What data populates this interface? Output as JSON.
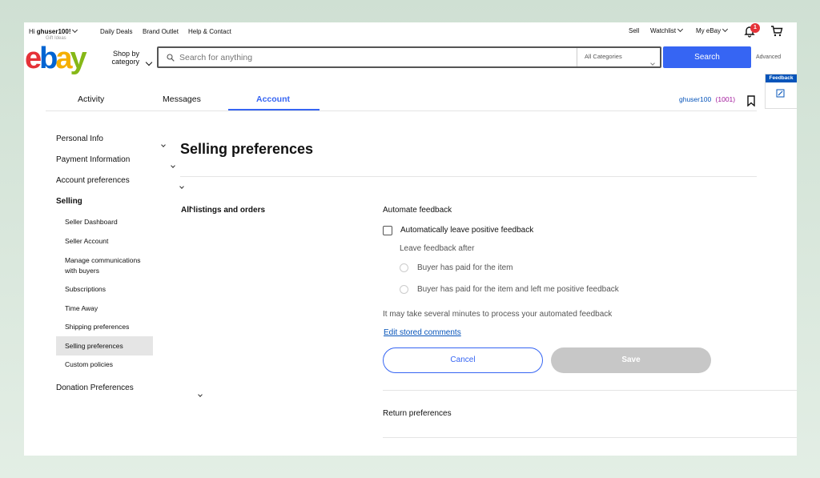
{
  "header": {
    "greeting_prefix": "Hi",
    "username": "ghuser100!",
    "greeting_sub": "Gift Ideas",
    "daily_deals": "Daily Deals",
    "brand_outlet": "Brand Outlet",
    "help_contact": "Help & Contact",
    "sell": "Sell",
    "watchlist": "Watchlist",
    "my_ebay": "My eBay",
    "notification_count": "1"
  },
  "logo": {
    "e": "e",
    "b": "b",
    "a": "a",
    "y": "y"
  },
  "search": {
    "shop_by_category": "Shop by category",
    "shop_line1": "Shop by",
    "shop_line2": "category",
    "placeholder": "Search for anything",
    "category": "All Categories",
    "button": "Search",
    "advanced": "Advanced"
  },
  "feedback_tab": {
    "label": "Feedback"
  },
  "tabs": [
    {
      "label": "Activity"
    },
    {
      "label": "Messages"
    },
    {
      "label": "Account"
    }
  ],
  "user": {
    "name": "ghuser100",
    "score": "(1001)"
  },
  "sidebar": {
    "personal_info": "Personal Info",
    "payment_information": "Payment Information",
    "account_preferences": "Account preferences",
    "selling": "Selling",
    "selling_items": [
      "Seller Dashboard",
      "Seller Account",
      "Manage communications with buyers",
      "Subscriptions",
      "Time Away",
      "Shipping preferences",
      "Selling preferences",
      "Custom policies"
    ],
    "manage_line1": "Manage communications",
    "manage_line2": "with buyers",
    "donation_preferences": "Donation Preferences"
  },
  "main": {
    "title": "Selling preferences",
    "section_label": "All listings and orders",
    "automate_feedback": "Automate feedback",
    "auto_leave_label": "Automatically leave positive feedback",
    "auto_leave_checked": false,
    "leave_after": "Leave feedback after",
    "option1": "Buyer has paid for the item",
    "option2": "Buyer has paid for the item and left me positive feedback",
    "note": "It may take several minutes to process your automated feedback",
    "edit_comments": "Edit stored comments",
    "cancel": "Cancel",
    "save": "Save",
    "return_preferences": "Return preferences"
  },
  "colors": {
    "accent": "#3665f3",
    "link": "#0654ba",
    "disabled": "#c7c7c7",
    "notification": "#e53238",
    "username": "#0654ba",
    "score": "#a2189c"
  }
}
